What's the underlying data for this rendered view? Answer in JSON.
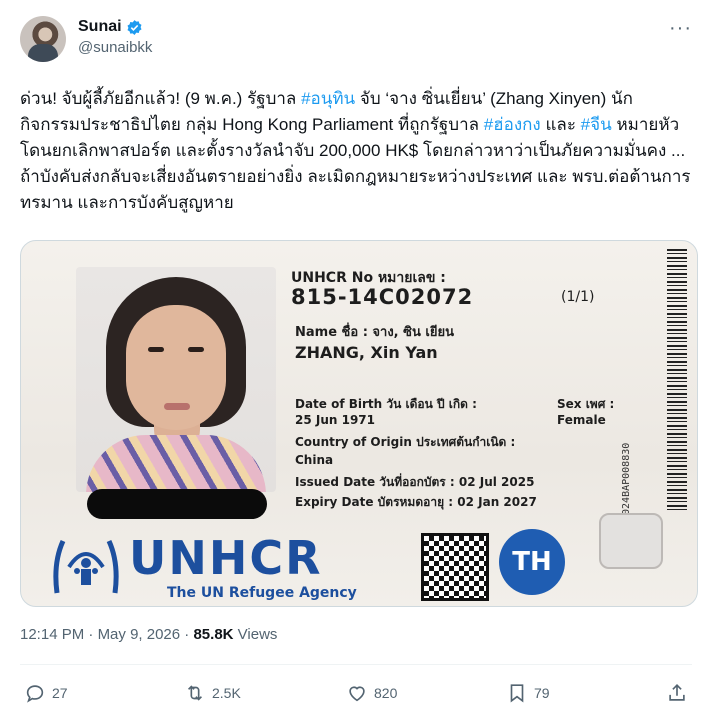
{
  "author": {
    "display_name": "Sunai",
    "handle": "@sunaibkk",
    "verified": true
  },
  "more_menu": "···",
  "tweet": {
    "segments": [
      {
        "text": "ด่วน! จับผู้ลี้ภัยอีกแล้ว! (9 พ.ค.) รัฐบาล ",
        "type": "text"
      },
      {
        "text": "#อนุทิน",
        "type": "hashtag"
      },
      {
        "text": " จับ ‘จาง ซิ่นเยี่ยน’ (Zhang Xinyen) นักกิจกรรมประชาธิปไตย กลุ่ม Hong Kong Parliament ที่ถูกรัฐบาล ",
        "type": "text"
      },
      {
        "text": "#ฮ่องกง",
        "type": "hashtag"
      },
      {
        "text": " และ ",
        "type": "text"
      },
      {
        "text": "#จีน",
        "type": "hashtag"
      },
      {
        "text": " หมายหัว โดนยกเลิกพาสปอร์ต และตั้งรางวัลนำจับ 200,000 HK$ โดยกล่าวหาว่าเป็นภัยความมั่นคง ... ถ้าบังคับส่งกลับจะเสี่ยงอันตรายอย่างยิ่ง ละเมิดกฎหมายระหว่างประเทศ และ พรบ.ต่อต้านการทรมาน และการบังคับสูญหาย",
        "type": "text"
      }
    ]
  },
  "card": {
    "unhcr_no_label": "UNHCR No หมายเลข :",
    "unhcr_no": "815-14C02072",
    "page": "(1/1)",
    "name_label": "Name ชื่อ : จาง, ซิน เยียน",
    "holder_name": "ZHANG, Xin Yan",
    "dob_label": "Date of Birth วัน เดือน ปี เกิด :",
    "dob": "25 Jun 1971",
    "sex_label": "Sex เพศ :",
    "sex": "Female",
    "coo_label": "Country of Origin ประเทศต้นกำเนิด :",
    "coo": "China",
    "issued": "Issued Date วันที่ออกบัตร : 02 Jul 2025",
    "expiry": "Expiry Date บัตรหมดอายุ : 02 Jan 2027",
    "serial": "2024BAP008830",
    "agency_word": "UNHCR",
    "agency_sub": "The UN Refugee Agency",
    "country_badge": "TH"
  },
  "meta": {
    "time": "12:14 PM",
    "separator": " · ",
    "date": "May 9, 2026",
    "views_count": "85.8K",
    "views_label": " Views"
  },
  "actions": {
    "replies": "27",
    "reposts": "2.5K",
    "likes": "820",
    "bookmarks": "79"
  },
  "colors": {
    "accent": "#1d9bf0",
    "text": "#0f1419",
    "muted": "#536471",
    "unhcr_blue": "#1d4f9e"
  }
}
